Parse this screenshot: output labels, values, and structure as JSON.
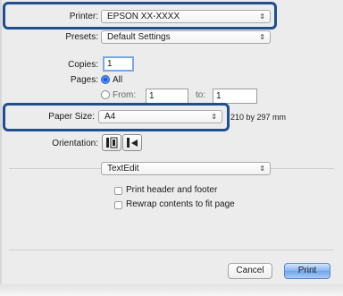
{
  "printer": {
    "label": "Printer:",
    "value": "EPSON XX-XXXX"
  },
  "presets": {
    "label": "Presets:",
    "value": "Default Settings"
  },
  "copies": {
    "label": "Copies:",
    "value": "1"
  },
  "pages": {
    "label": "Pages:",
    "all_label": "All",
    "from_label": "From:",
    "from_value": "1",
    "to_label": "to:",
    "to_value": "1"
  },
  "paper_size": {
    "label": "Paper Size:",
    "value": "A4",
    "dimensions": "210 by 297 mm"
  },
  "orientation": {
    "label": "Orientation:"
  },
  "app_section": {
    "value": "TextEdit"
  },
  "options": {
    "print_header_footer": "Print header and footer",
    "rewrap": "Rewrap contents to fit page"
  },
  "buttons": {
    "cancel": "Cancel",
    "print": "Print"
  },
  "colors": {
    "highlight": "#1f4f8f",
    "default_button": "#6fa2ec"
  }
}
